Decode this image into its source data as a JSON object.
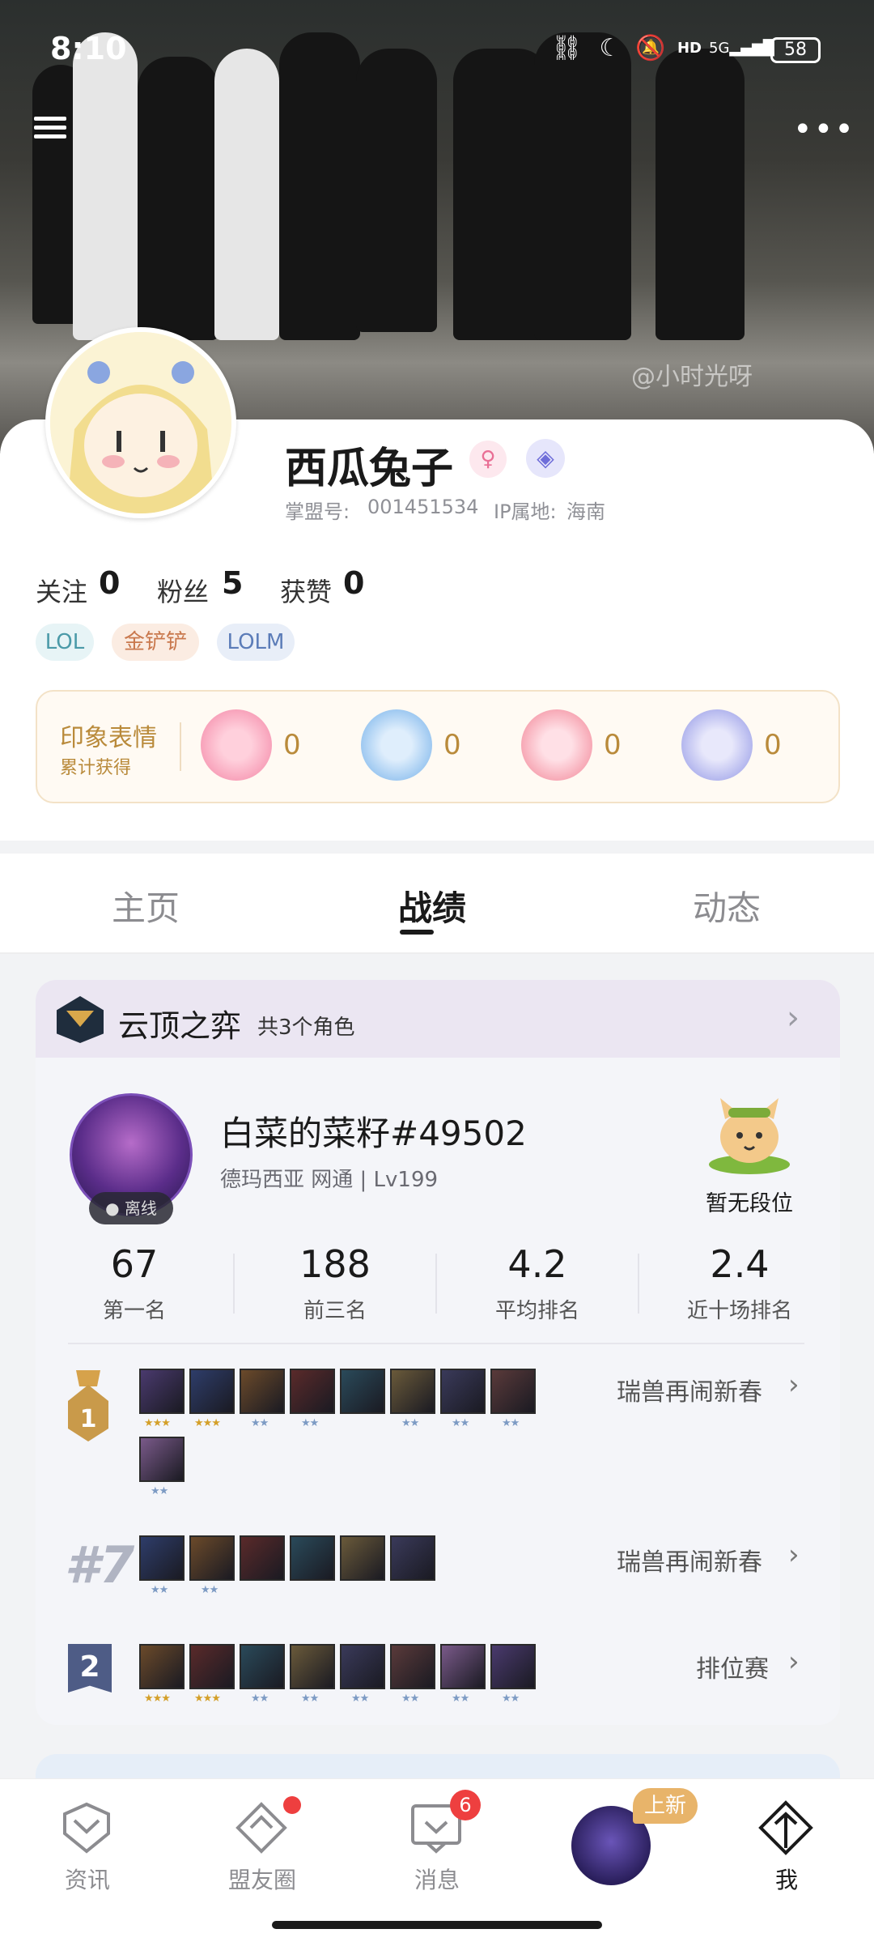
{
  "status_bar": {
    "time": "8:10",
    "battery": "58"
  },
  "profile": {
    "nickname": "西瓜兔子",
    "id_label": "掌盟号:",
    "id_value": "001451534",
    "ip_label": "IP属地:",
    "ip_value": "海南",
    "cover_watermark": "@小时光呀",
    "stats": [
      {
        "label": "关注",
        "value": "0"
      },
      {
        "label": "粉丝",
        "value": "5"
      },
      {
        "label": "获赞",
        "value": "0"
      }
    ],
    "tags": [
      "LOL",
      "金铲铲",
      "LOLM"
    ]
  },
  "impressions": {
    "title": "印象表情",
    "subtitle": "累计获得",
    "counts": [
      "0",
      "0",
      "0",
      "0"
    ]
  },
  "tabs": {
    "items": [
      "主页",
      "战绩",
      "动态"
    ],
    "active": "战绩"
  },
  "game_card": {
    "name": "云顶之弈",
    "roles_count": "共3个角色",
    "role": {
      "name": "白菜的菜籽#49502",
      "server": "德玛西亚 网通 | Lv199",
      "status": "离线",
      "rank": "暂无段位"
    },
    "summary": [
      {
        "value": "67",
        "label": "第一名"
      },
      {
        "value": "188",
        "label": "前三名"
      },
      {
        "value": "4.2",
        "label": "平均排名"
      },
      {
        "value": "2.4",
        "label": "近十场排名"
      }
    ],
    "matches": [
      {
        "place": "1",
        "mode": "瑞兽再闹新春",
        "champions": 9,
        "stars": [
          "★★★",
          "★★★",
          "★★",
          "★★",
          "",
          "★★",
          "★★",
          "★★",
          "★★"
        ]
      },
      {
        "place": "#7",
        "mode": "瑞兽再闹新春",
        "champions": 6,
        "stars": [
          "★★",
          "★★",
          "",
          "",
          "",
          ""
        ]
      },
      {
        "place": "2",
        "mode": "排位赛",
        "champions": 8,
        "stars": [
          "★★★",
          "★★★",
          "★★",
          "★★",
          "★★",
          "★★",
          "★★",
          "★★"
        ]
      }
    ]
  },
  "nav": {
    "items": [
      "资讯",
      "盟友圈",
      "消息",
      "",
      "我"
    ],
    "message_badge": "6",
    "new_badge": "上新"
  },
  "colors": {
    "accent_gold": "#b98a3a",
    "badge_red": "#ee3f3f",
    "tag_orange": "#e8b46a"
  }
}
